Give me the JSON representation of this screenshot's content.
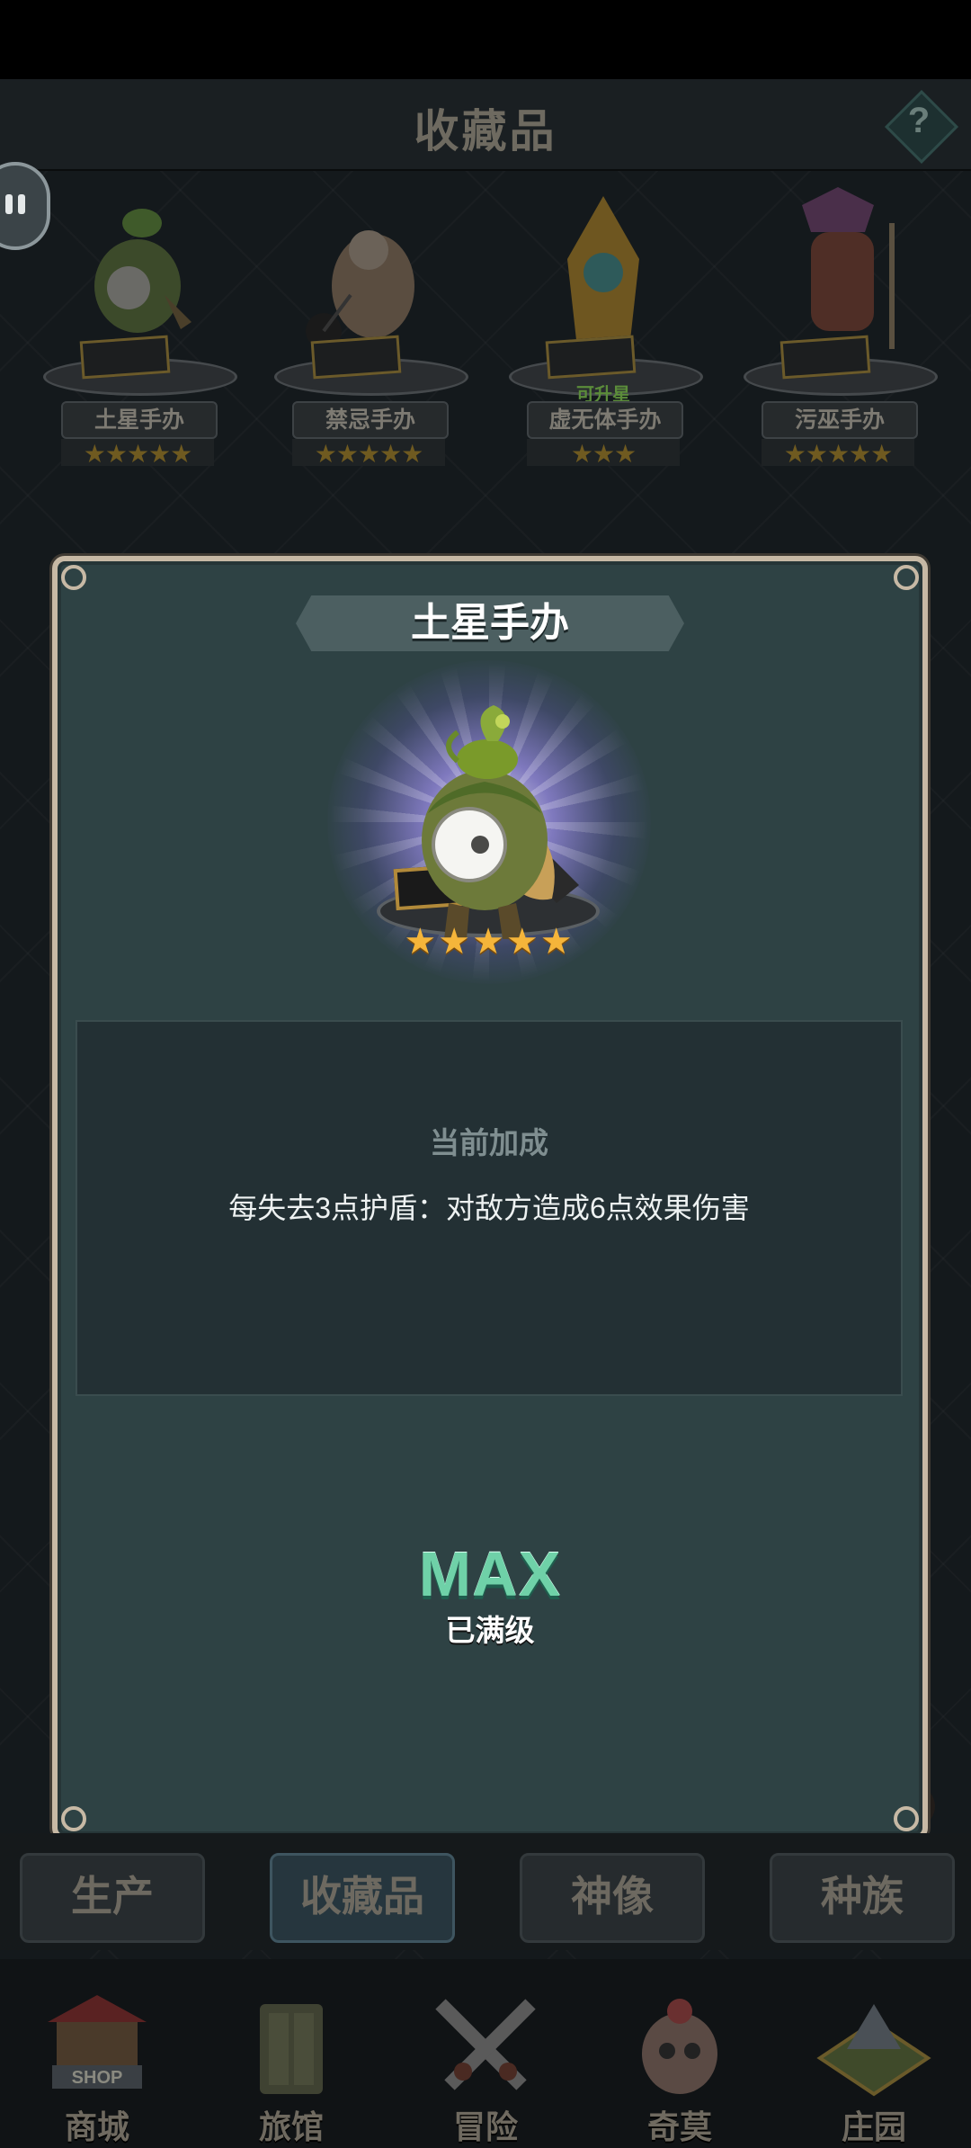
{
  "header": {
    "title": "收藏品",
    "help_symbol": "?"
  },
  "figurines": [
    {
      "name": "土星手办",
      "stars": "★★★★★",
      "tag": ""
    },
    {
      "name": "禁忌手办",
      "stars": "★★★★★",
      "tag": ""
    },
    {
      "name": "虚无体手办",
      "stars": "★★★",
      "tag": "可升星"
    },
    {
      "name": "污巫手办",
      "stars": "★★★★★",
      "tag": ""
    }
  ],
  "dialog": {
    "title": "土星手办",
    "stars": "★★★★★",
    "bonus_title": "当前加成",
    "bonus_desc": "每失去3点护盾：对敌方造成6点效果伤害",
    "max_label": "MAX",
    "max_sub": "已满级"
  },
  "tabs": [
    {
      "label": "生产",
      "active": false
    },
    {
      "label": "收藏品",
      "active": true
    },
    {
      "label": "神像",
      "active": false
    },
    {
      "label": "种族",
      "active": false
    }
  ],
  "nav": [
    {
      "label": "商城",
      "icon": "shop-icon",
      "icon_text": "SHOP"
    },
    {
      "label": "旅馆",
      "icon": "inn-icon"
    },
    {
      "label": "冒险",
      "icon": "crossed-swords-icon"
    },
    {
      "label": "奇莫",
      "icon": "pet-icon"
    },
    {
      "label": "庄园",
      "icon": "manor-icon"
    }
  ],
  "colors": {
    "dialog_bg": "#2e4244",
    "dialog_border": "#c7b9a5",
    "star": "#f5b53a",
    "max": "#6fd1a8",
    "upgrade_tag": "#5b8c3a"
  }
}
